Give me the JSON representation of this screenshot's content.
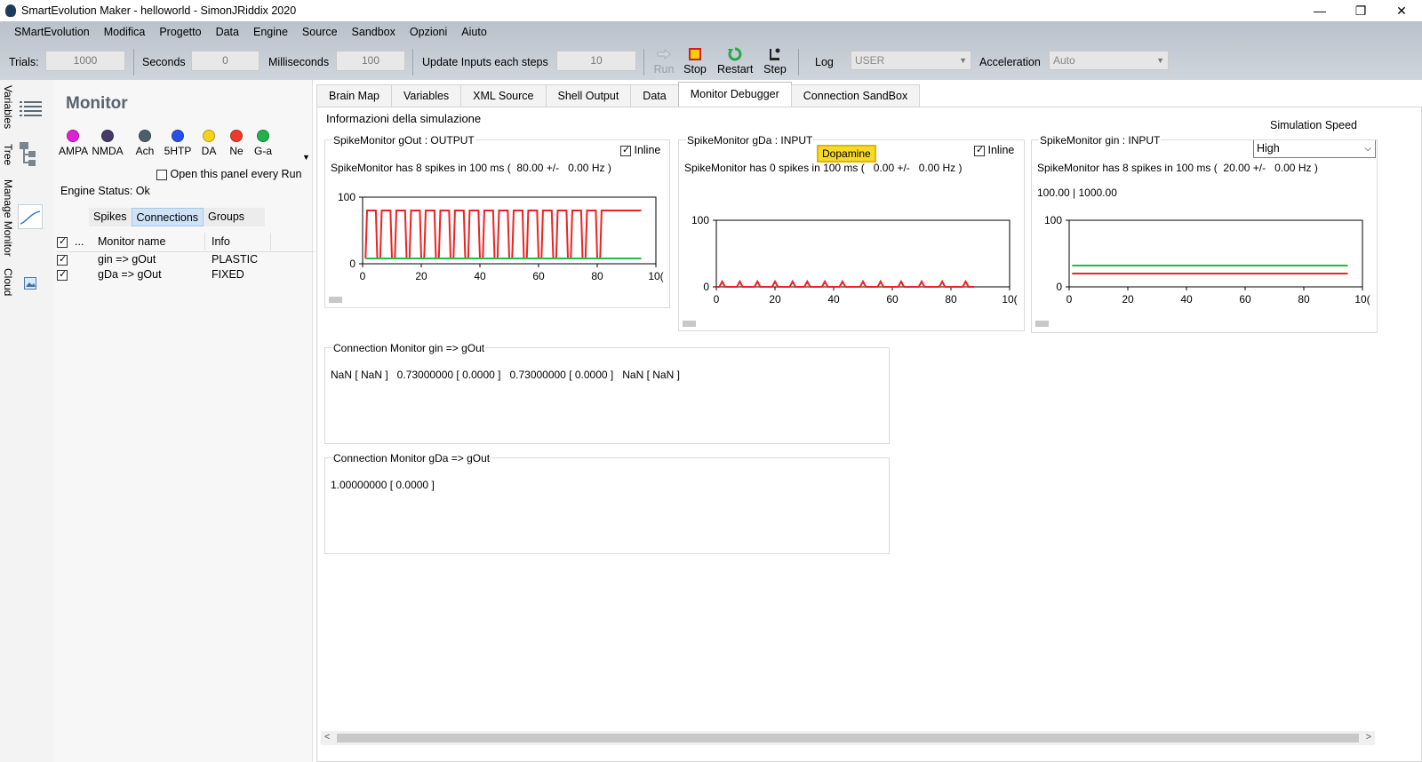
{
  "window": {
    "title": "SmartEvolution Maker - helloworld - SimonJRiddix 2020",
    "controls": {
      "minimize": "—",
      "restore": "❐",
      "close": "✕"
    }
  },
  "menu": [
    "SMartEvolution",
    "Modifica",
    "Progetto",
    "Data",
    "Engine",
    "Source",
    "Sandbox",
    "Opzioni",
    "Aiuto"
  ],
  "toolbar": {
    "trials_label": "Trials:",
    "trials_value": "1000",
    "seconds_label": "Seconds",
    "seconds_value": "0",
    "milliseconds_label": "Milliseconds",
    "milliseconds_value": "100",
    "update_label": "Update Inputs each steps",
    "update_value": "10",
    "run_label": "Run",
    "stop_label": "Stop",
    "restart_label": "Restart",
    "step_label": "Step",
    "log_label": "Log",
    "log_value": "USER",
    "acceleration_label": "Acceleration",
    "acceleration_value": "Auto",
    "colors": {
      "stop": "#f5d000",
      "stop_border": "#d02020",
      "restart": "#2aa84a"
    }
  },
  "sidebar": {
    "vtabs": [
      "Variables",
      "Tree",
      "Manage Monitor",
      "Cloud"
    ]
  },
  "monitor": {
    "title": "Monitor",
    "neurotransmitters": [
      {
        "label": "AMPA",
        "color": "#e020d8"
      },
      {
        "label": "NMDA",
        "color": "#453a6a"
      },
      {
        "label": "Ach",
        "color": "#4a6066"
      },
      {
        "label": "5HTP",
        "color": "#2850e8"
      },
      {
        "label": "DA",
        "color": "#f8d21c"
      },
      {
        "label": "Ne",
        "color": "#ee3a2a"
      },
      {
        "label": "G-a",
        "color": "#22b04a"
      }
    ],
    "open_every_run": "Open this panel every Run",
    "engine_status": "Engine Status: Ok",
    "subtabs": [
      "Spikes",
      "Connections",
      "Groups"
    ],
    "table": {
      "dots": "...",
      "col_name": "Monitor name",
      "col_info": "Info",
      "rows": [
        {
          "name": "gin => gOut",
          "info": "PLASTIC"
        },
        {
          "name": "gDa => gOut",
          "info": "FIXED"
        }
      ]
    }
  },
  "tabs": [
    "Brain Map",
    "Variables",
    "XML Source",
    "Shell Output",
    "Data",
    "Monitor Debugger",
    "Connection SandBox"
  ],
  "debugger": {
    "heading": "Informazioni della simulazione",
    "sim_speed_label": "Simulation Speed",
    "sim_speed_value": "High",
    "inline_label": "Inline",
    "dopamine_tooltip": "Dopamine",
    "monitors": [
      {
        "title": "SpikeMonitor gOut : OUTPUT",
        "stats": "SpikeMonitor has 8 spikes in 100 ms (  80.00 +/-   0.00 Hz )",
        "extra": ""
      },
      {
        "title": "SpikeMonitor gDa : INPUT",
        "stats": "SpikeMonitor has 0 spikes in 100 ms (   0.00 +/-   0.00 Hz )",
        "extra": ""
      },
      {
        "title": "SpikeMonitor gin : INPUT",
        "stats": "SpikeMonitor has 8 spikes in 100 ms (  20.00 +/-   0.00 Hz )",
        "extra": "100.00 | 1000.00"
      }
    ],
    "connections": [
      {
        "title": "Connection Monitor gin => gOut",
        "text": "NaN [ NaN ]   0.73000000 [ 0.0000 ]   0.73000000 [ 0.0000 ]   NaN [ NaN ]"
      },
      {
        "title": "Connection Monitor gDa => gOut",
        "text": "1.00000000 [ 0.0000 ]"
      }
    ]
  },
  "chart_data": [
    {
      "type": "line",
      "title": "SpikeMonitor gOut : OUTPUT",
      "xlim": [
        0,
        100
      ],
      "ylim": [
        0,
        100
      ],
      "xticks": [
        0,
        20,
        40,
        60,
        80,
        100
      ],
      "yticks": [
        0,
        100
      ],
      "x_tick_labels": [
        "0",
        "20",
        "40",
        "60",
        "80",
        "10("
      ],
      "y_tick_labels": [
        "0",
        "100"
      ],
      "series": [
        {
          "color": "#ee2222",
          "pattern": "square",
          "low": 8,
          "high": 80,
          "pulses": [
            [
              1,
              5
            ],
            [
              6,
              10
            ],
            [
              11,
              15
            ],
            [
              16,
              20
            ],
            [
              21,
              25
            ],
            [
              26,
              30
            ],
            [
              31,
              35
            ],
            [
              36,
              40
            ],
            [
              41,
              45
            ],
            [
              46,
              50
            ],
            [
              51,
              55
            ],
            [
              56,
              60
            ],
            [
              61,
              65
            ],
            [
              66,
              70
            ],
            [
              71,
              75
            ],
            [
              76,
              80
            ],
            [
              81,
              95
            ]
          ]
        },
        {
          "color": "#22bb44",
          "y_const": 8,
          "x_range": [
            1,
            95
          ]
        }
      ]
    },
    {
      "type": "line",
      "title": "SpikeMonitor gDa : INPUT",
      "xlim": [
        0,
        100
      ],
      "ylim": [
        0,
        100
      ],
      "xticks": [
        0,
        20,
        40,
        60,
        80,
        100
      ],
      "yticks": [
        0,
        100
      ],
      "x_tick_labels": [
        "0",
        "20",
        "40",
        "60",
        "80",
        "10("
      ],
      "y_tick_labels": [
        "0",
        "100"
      ],
      "series": [
        {
          "color": "#ee2222",
          "pattern": "spikes",
          "baseline": 0,
          "peak": 8,
          "x": [
            2,
            8,
            14,
            20,
            26,
            31,
            37,
            43,
            50,
            56,
            63,
            70,
            77,
            85
          ]
        }
      ]
    },
    {
      "type": "line",
      "title": "SpikeMonitor gin : INPUT",
      "xlim": [
        0,
        100
      ],
      "ylim": [
        0,
        100
      ],
      "xticks": [
        0,
        20,
        40,
        60,
        80,
        100
      ],
      "yticks": [
        0,
        100
      ],
      "x_tick_labels": [
        "0",
        "20",
        "40",
        "60",
        "80",
        "10("
      ],
      "y_tick_labels": [
        "0",
        "100"
      ],
      "series": [
        {
          "color": "#22bb44",
          "y_const": 32,
          "x_range": [
            1,
            95
          ]
        },
        {
          "color": "#ee2222",
          "y_const": 20,
          "x_range": [
            1,
            95
          ]
        }
      ]
    }
  ]
}
